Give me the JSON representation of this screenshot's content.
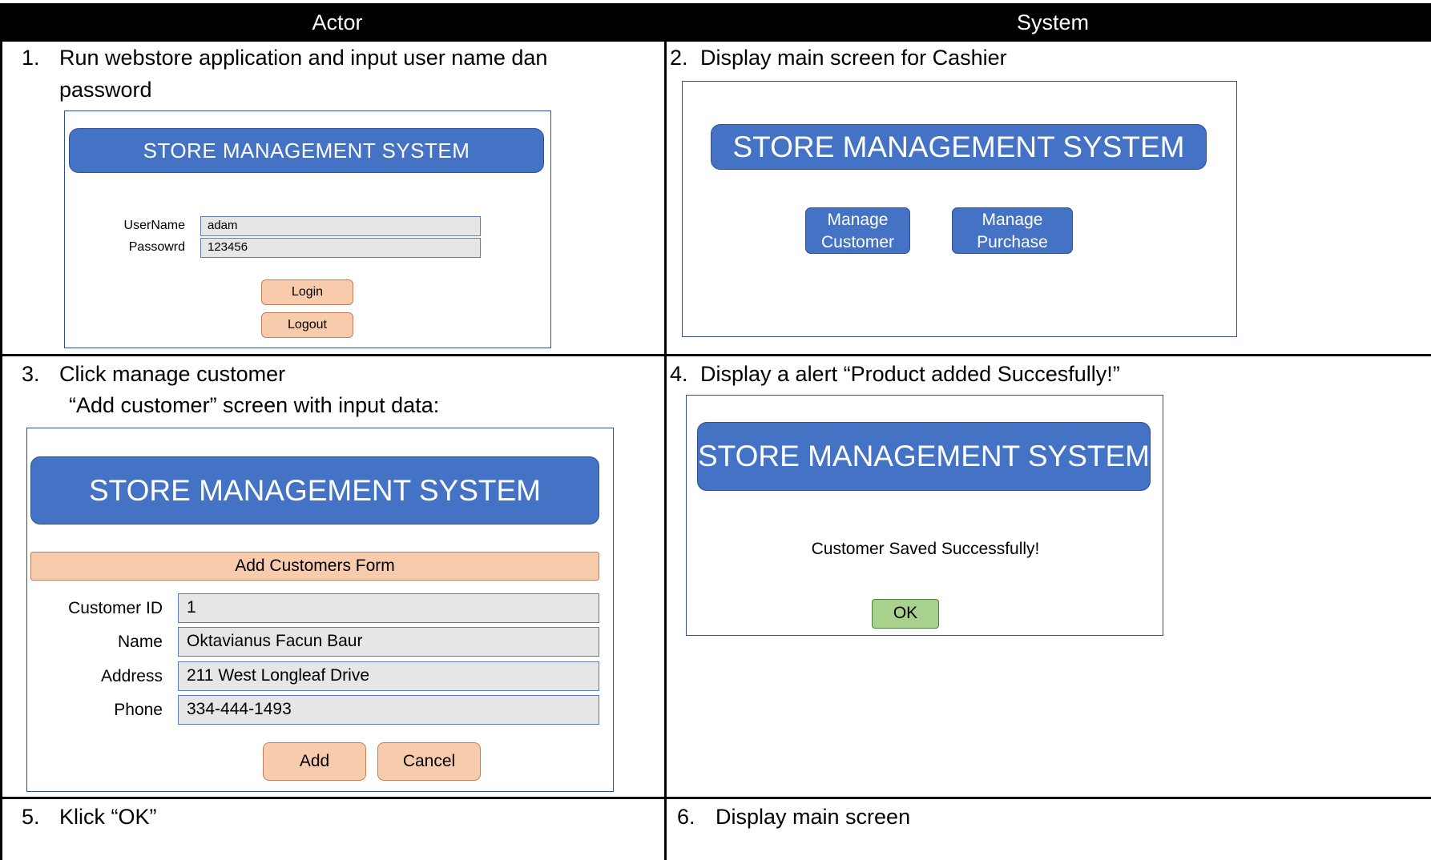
{
  "header": {
    "actor": "Actor",
    "system": "System"
  },
  "steps": {
    "s1": {
      "num": "1.",
      "text_line1": "Run webstore application and input user name dan",
      "text_line2": "password"
    },
    "s2": {
      "num": "2.",
      "text": "Display main screen for Cashier"
    },
    "s3": {
      "num": "3.",
      "text_line1": "Click manage customer",
      "text_line2": "“Add customer” screen with input data:"
    },
    "s4": {
      "num": "4.",
      "text": "Display a alert “Product added Succesfully!”"
    },
    "s5": {
      "num": "5.",
      "text": "Klick “OK”"
    },
    "s6": {
      "num": "6.",
      "text": "Display main screen"
    }
  },
  "login_screen": {
    "title": "STORE MANAGEMENT SYSTEM",
    "username_label": "UserName",
    "username_value": "adam",
    "password_label": "Passowrd",
    "password_value": "123456",
    "login_button": "Login",
    "logout_button": "Logout"
  },
  "main_screen": {
    "title": "STORE MANAGEMENT SYSTEM",
    "manage_customer_line1": "Manage",
    "manage_customer_line2": "Customer",
    "manage_purchase_line1": "Manage",
    "manage_purchase_line2": "Purchase"
  },
  "add_customer_screen": {
    "title": "STORE MANAGEMENT SYSTEM",
    "form_title": "Add Customers Form",
    "fields": [
      {
        "label": "Customer ID",
        "value": "1"
      },
      {
        "label": "Name",
        "value": "Oktavianus Facun Baur"
      },
      {
        "label": "Address",
        "value": "211 West Longleaf Drive"
      },
      {
        "label": "Phone",
        "value": "334-444-1493"
      }
    ],
    "add_button": "Add",
    "cancel_button": "Cancel"
  },
  "alert_screen": {
    "title": "STORE MANAGEMENT SYSTEM",
    "message": "Customer Saved Successfully!",
    "ok_button": "OK"
  },
  "colors": {
    "banner": "#4472c4",
    "peach_button": "#f8cbad",
    "green_button": "#a9d18e",
    "field_bg": "#e6e6e6",
    "header_bg": "#000000"
  }
}
